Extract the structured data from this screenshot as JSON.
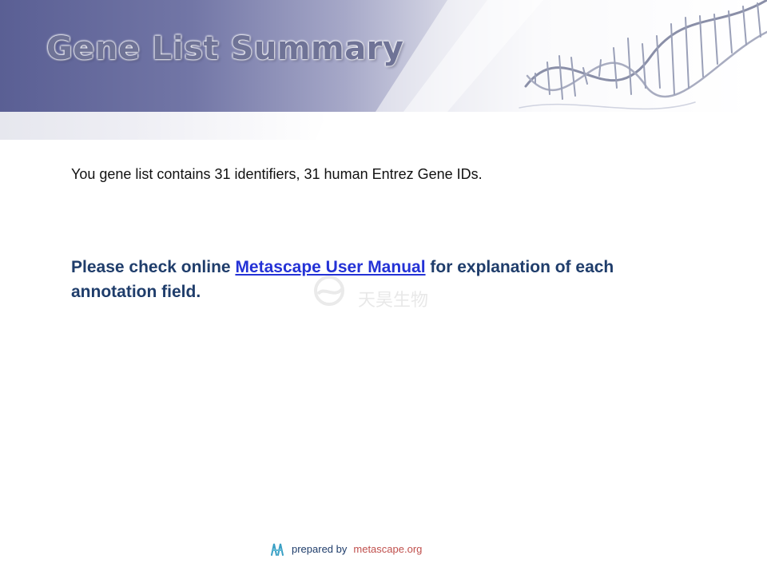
{
  "header": {
    "title": "Gene List Summary"
  },
  "main": {
    "summary_text": "You gene list contains 31 identifiers, 31 human Entrez Gene IDs.",
    "note_prefix": "Please check online ",
    "manual_link_label": "Metascape User Manual",
    "note_suffix": " for explanation of each annotation field."
  },
  "watermark": {
    "text": "天昊生物"
  },
  "footer": {
    "prepared_by": "prepared by",
    "site": "metascape.org"
  },
  "icons": {
    "dna": "dna-helix-icon",
    "logo": "metascape-logo-icon"
  },
  "colors": {
    "header_band": "#5d6296",
    "title": "#6f7396",
    "note_text": "#1f3d6b",
    "link": "#2432d6",
    "footer_site": "#c0504d"
  }
}
